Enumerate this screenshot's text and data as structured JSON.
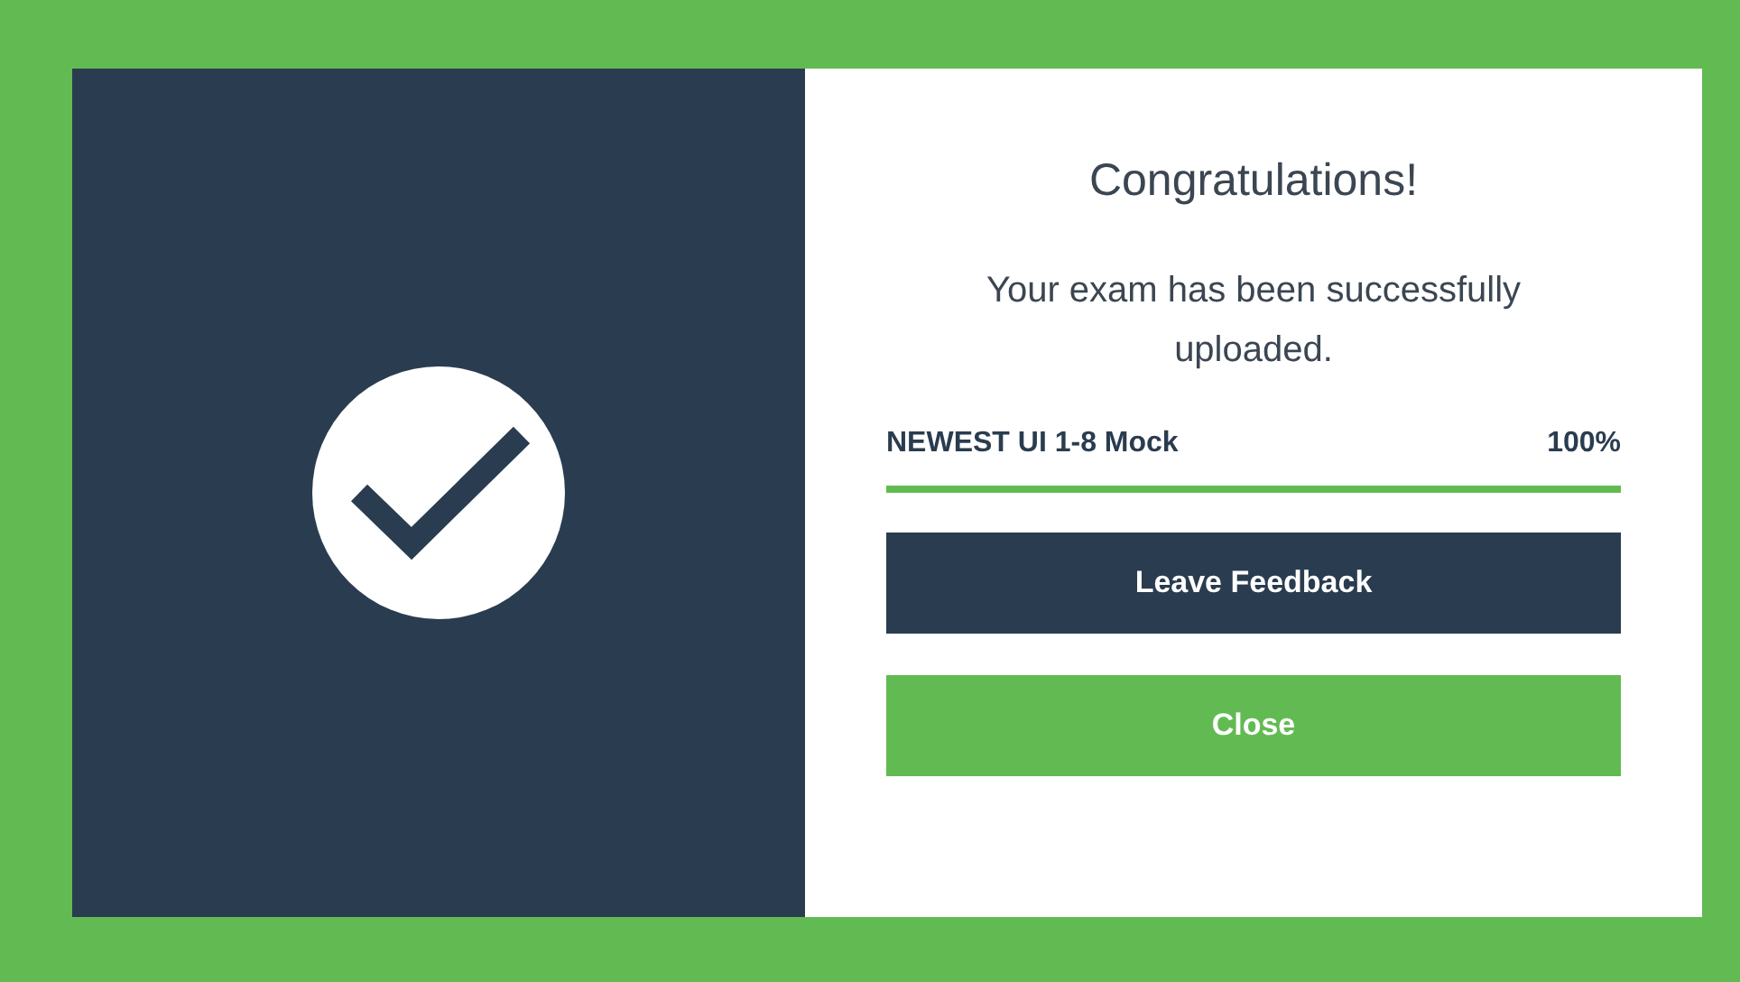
{
  "dialog": {
    "title": "Congratulations!",
    "message": "Your exam has been successfully uploaded.",
    "upload": {
      "name": "NEWEST UI 1-8 Mock",
      "percent": "100%",
      "level": 1
    },
    "buttons": [
      {
        "label": "Leave Feedback",
        "kind": "secondary"
      },
      {
        "label": "Close",
        "kind": "primary"
      }
    ]
  }
}
